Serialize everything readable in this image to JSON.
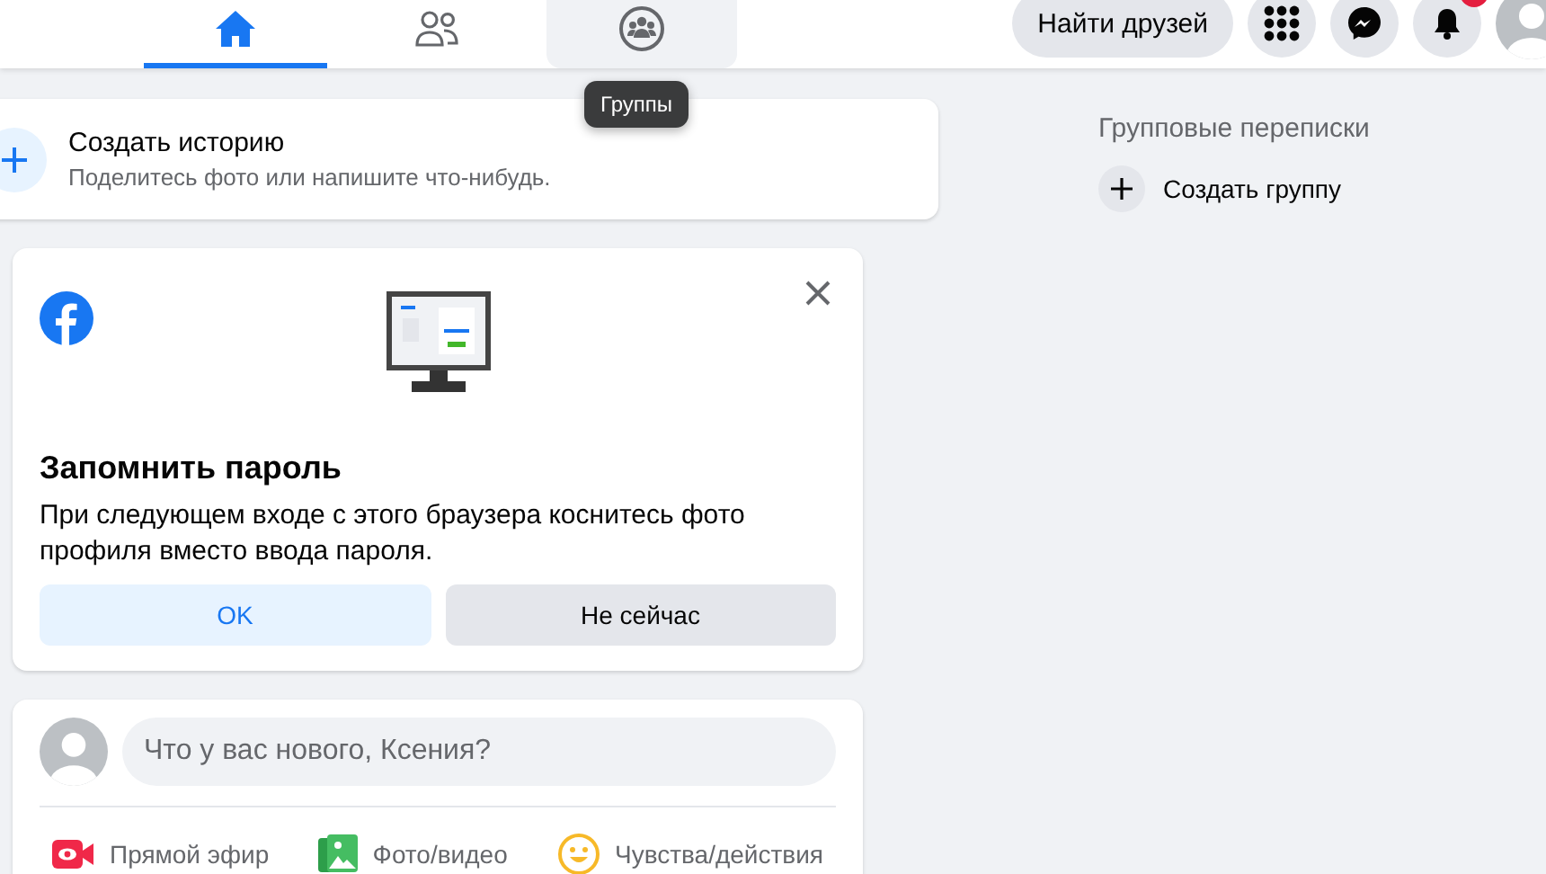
{
  "top_bar": {
    "tabs": [
      {
        "kind": "home",
        "selected": true,
        "hovered": false
      },
      {
        "kind": "friends",
        "selected": false,
        "hovered": false
      },
      {
        "kind": "groups",
        "selected": false,
        "hovered": true
      }
    ],
    "tooltip": "Группы",
    "find_friends": "Найти друзей",
    "notifications_badge": true
  },
  "story": {
    "title": "Создать историю",
    "subtitle": "Поделитесь фото или напишите что-нибудь."
  },
  "remember_password": {
    "title": "Запомнить пароль",
    "text": "При следующем входе с этого браузера коснитесь фото профиля вместо ввода пароля.",
    "buttons": [
      {
        "label": "OK",
        "kind": "primary"
      },
      {
        "label": "Не сейчас",
        "kind": "secondary"
      }
    ]
  },
  "composer": {
    "placeholder": "Что у вас нового, Ксения?",
    "actions": [
      {
        "kind": "live",
        "label": "Прямой эфир"
      },
      {
        "kind": "photo",
        "label": "Фото/видео"
      },
      {
        "kind": "feeling",
        "label": "Чувства/действия"
      }
    ]
  },
  "sidebar": {
    "heading": "Групповые переписки",
    "create": "Создать группу"
  }
}
